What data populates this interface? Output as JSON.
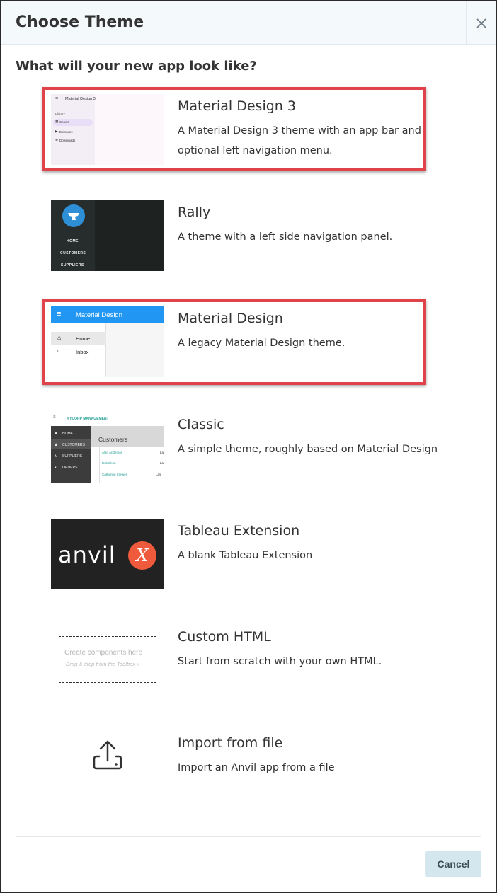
{
  "header": {
    "title": "Choose Theme",
    "close_icon": "close-icon"
  },
  "subtitle": "What will your new app look like?",
  "themes": [
    {
      "title": "Material Design 3",
      "description": "A Material Design 3 theme with an app bar and optional left navigation menu.",
      "highlighted": true,
      "thumb": {
        "app_title": "Material Design 3",
        "section": "Library",
        "items": [
          "Shows",
          "Episodes",
          "Downloads"
        ]
      }
    },
    {
      "title": "Rally",
      "description": "A theme with a left side navigation panel.",
      "highlighted": false,
      "thumb": {
        "items": [
          "HOME",
          "CUSTOMERS",
          "SUPPLIERS"
        ]
      }
    },
    {
      "title": "Material Design",
      "description": "A legacy Material Design theme.",
      "highlighted": true,
      "thumb": {
        "app_title": "Material Design",
        "items": [
          "Home",
          "Inbox"
        ]
      }
    },
    {
      "title": "Classic",
      "description": "A simple theme, roughly based on Material Design",
      "highlighted": false,
      "thumb": {
        "brand": "MYCORP MANAGEMENT",
        "items": [
          "HOME",
          "CUSTOMERS",
          "SUPPLIERS",
          "ORDERS"
        ],
        "heading": "Customers",
        "rows": [
          [
            "Alan Anderson",
            "La"
          ],
          [
            "Bob Blunt",
            "La"
          ],
          [
            "Catherine Crewell",
            "Las"
          ]
        ]
      }
    },
    {
      "title": "Tableau Extension",
      "description": "A blank Tableau Extension",
      "highlighted": false,
      "thumb": {
        "logo_text": "anvil",
        "logo_mark": "X"
      }
    },
    {
      "title": "Custom HTML",
      "description": "Start from scratch with your own HTML.",
      "highlighted": false,
      "thumb": {
        "line1": "Create components here",
        "line2": "Drag & drop from the Toolbox »"
      }
    },
    {
      "title": "Import from file",
      "description": "Import an Anvil app from a file",
      "highlighted": false,
      "thumb": {
        "icon": "upload-icon"
      }
    }
  ],
  "footer": {
    "cancel_label": "Cancel"
  },
  "colors": {
    "highlight": "#e0434a",
    "header_bg": "#f4f9fc",
    "cancel_bg": "#d4e7ef",
    "md_blue": "#2196f3"
  }
}
